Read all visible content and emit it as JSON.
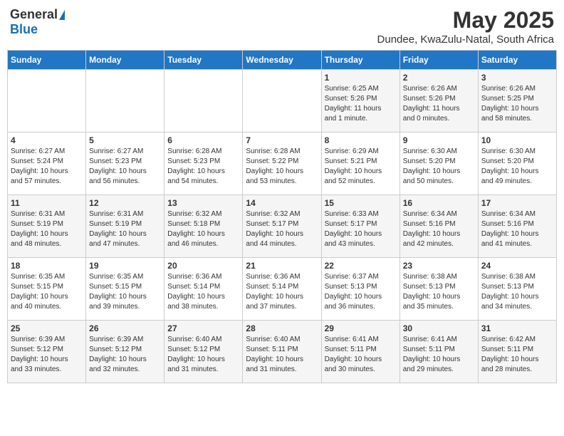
{
  "logo": {
    "general": "General",
    "blue": "Blue"
  },
  "title": "May 2025",
  "subtitle": "Dundee, KwaZulu-Natal, South Africa",
  "days_of_week": [
    "Sunday",
    "Monday",
    "Tuesday",
    "Wednesday",
    "Thursday",
    "Friday",
    "Saturday"
  ],
  "weeks": [
    [
      {
        "day": "",
        "info": ""
      },
      {
        "day": "",
        "info": ""
      },
      {
        "day": "",
        "info": ""
      },
      {
        "day": "",
        "info": ""
      },
      {
        "day": "1",
        "info": "Sunrise: 6:25 AM\nSunset: 5:26 PM\nDaylight: 11 hours\nand 1 minute."
      },
      {
        "day": "2",
        "info": "Sunrise: 6:26 AM\nSunset: 5:26 PM\nDaylight: 11 hours\nand 0 minutes."
      },
      {
        "day": "3",
        "info": "Sunrise: 6:26 AM\nSunset: 5:25 PM\nDaylight: 10 hours\nand 58 minutes."
      }
    ],
    [
      {
        "day": "4",
        "info": "Sunrise: 6:27 AM\nSunset: 5:24 PM\nDaylight: 10 hours\nand 57 minutes."
      },
      {
        "day": "5",
        "info": "Sunrise: 6:27 AM\nSunset: 5:23 PM\nDaylight: 10 hours\nand 56 minutes."
      },
      {
        "day": "6",
        "info": "Sunrise: 6:28 AM\nSunset: 5:23 PM\nDaylight: 10 hours\nand 54 minutes."
      },
      {
        "day": "7",
        "info": "Sunrise: 6:28 AM\nSunset: 5:22 PM\nDaylight: 10 hours\nand 53 minutes."
      },
      {
        "day": "8",
        "info": "Sunrise: 6:29 AM\nSunset: 5:21 PM\nDaylight: 10 hours\nand 52 minutes."
      },
      {
        "day": "9",
        "info": "Sunrise: 6:30 AM\nSunset: 5:20 PM\nDaylight: 10 hours\nand 50 minutes."
      },
      {
        "day": "10",
        "info": "Sunrise: 6:30 AM\nSunset: 5:20 PM\nDaylight: 10 hours\nand 49 minutes."
      }
    ],
    [
      {
        "day": "11",
        "info": "Sunrise: 6:31 AM\nSunset: 5:19 PM\nDaylight: 10 hours\nand 48 minutes."
      },
      {
        "day": "12",
        "info": "Sunrise: 6:31 AM\nSunset: 5:19 PM\nDaylight: 10 hours\nand 47 minutes."
      },
      {
        "day": "13",
        "info": "Sunrise: 6:32 AM\nSunset: 5:18 PM\nDaylight: 10 hours\nand 46 minutes."
      },
      {
        "day": "14",
        "info": "Sunrise: 6:32 AM\nSunset: 5:17 PM\nDaylight: 10 hours\nand 44 minutes."
      },
      {
        "day": "15",
        "info": "Sunrise: 6:33 AM\nSunset: 5:17 PM\nDaylight: 10 hours\nand 43 minutes."
      },
      {
        "day": "16",
        "info": "Sunrise: 6:34 AM\nSunset: 5:16 PM\nDaylight: 10 hours\nand 42 minutes."
      },
      {
        "day": "17",
        "info": "Sunrise: 6:34 AM\nSunset: 5:16 PM\nDaylight: 10 hours\nand 41 minutes."
      }
    ],
    [
      {
        "day": "18",
        "info": "Sunrise: 6:35 AM\nSunset: 5:15 PM\nDaylight: 10 hours\nand 40 minutes."
      },
      {
        "day": "19",
        "info": "Sunrise: 6:35 AM\nSunset: 5:15 PM\nDaylight: 10 hours\nand 39 minutes."
      },
      {
        "day": "20",
        "info": "Sunrise: 6:36 AM\nSunset: 5:14 PM\nDaylight: 10 hours\nand 38 minutes."
      },
      {
        "day": "21",
        "info": "Sunrise: 6:36 AM\nSunset: 5:14 PM\nDaylight: 10 hours\nand 37 minutes."
      },
      {
        "day": "22",
        "info": "Sunrise: 6:37 AM\nSunset: 5:13 PM\nDaylight: 10 hours\nand 36 minutes."
      },
      {
        "day": "23",
        "info": "Sunrise: 6:38 AM\nSunset: 5:13 PM\nDaylight: 10 hours\nand 35 minutes."
      },
      {
        "day": "24",
        "info": "Sunrise: 6:38 AM\nSunset: 5:13 PM\nDaylight: 10 hours\nand 34 minutes."
      }
    ],
    [
      {
        "day": "25",
        "info": "Sunrise: 6:39 AM\nSunset: 5:12 PM\nDaylight: 10 hours\nand 33 minutes."
      },
      {
        "day": "26",
        "info": "Sunrise: 6:39 AM\nSunset: 5:12 PM\nDaylight: 10 hours\nand 32 minutes."
      },
      {
        "day": "27",
        "info": "Sunrise: 6:40 AM\nSunset: 5:12 PM\nDaylight: 10 hours\nand 31 minutes."
      },
      {
        "day": "28",
        "info": "Sunrise: 6:40 AM\nSunset: 5:11 PM\nDaylight: 10 hours\nand 31 minutes."
      },
      {
        "day": "29",
        "info": "Sunrise: 6:41 AM\nSunset: 5:11 PM\nDaylight: 10 hours\nand 30 minutes."
      },
      {
        "day": "30",
        "info": "Sunrise: 6:41 AM\nSunset: 5:11 PM\nDaylight: 10 hours\nand 29 minutes."
      },
      {
        "day": "31",
        "info": "Sunrise: 6:42 AM\nSunset: 5:11 PM\nDaylight: 10 hours\nand 28 minutes."
      }
    ]
  ]
}
